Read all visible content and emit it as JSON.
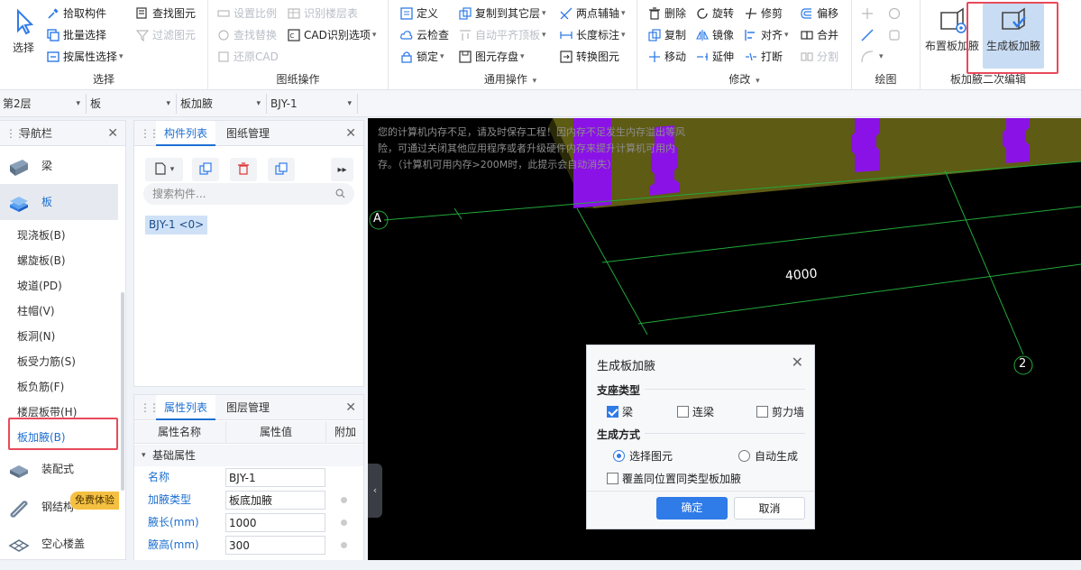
{
  "ribbon": {
    "select_group": {
      "big_button": "选择",
      "items": [
        "拾取构件",
        "批量选择",
        "按属性选择"
      ],
      "items2": [
        "查找图元",
        "过滤图元"
      ],
      "label": "选择"
    },
    "drawing_ops": {
      "items": [
        "设置比例",
        "查找替换",
        "还原CAD"
      ],
      "items2": [
        "识别楼层表",
        "CAD识别选项"
      ],
      "label": "图纸操作"
    },
    "common_ops": {
      "col1": [
        "定义",
        "云检查",
        "锁定"
      ],
      "col2": [
        "复制到其它层",
        "自动平齐顶板",
        "图元存盘"
      ],
      "col3": [
        "两点辅轴",
        "长度标注",
        "转换图元"
      ],
      "label": "通用操作"
    },
    "modify": {
      "col1": [
        "删除",
        "复制",
        "移动"
      ],
      "col2": [
        "旋转",
        "镜像",
        "延伸"
      ],
      "col3": [
        "修剪",
        "对齐",
        "打断"
      ],
      "col4": [
        "偏移",
        "合并",
        "分割"
      ],
      "label": "修改"
    },
    "draw": {
      "label": "绘图"
    },
    "haunch_edit": {
      "btn_place": "布置板加腋",
      "btn_generate": "生成板加腋",
      "label": "板加腋二次编辑"
    }
  },
  "combos": [
    "第2层",
    "板",
    "板加腋",
    "BJY-1"
  ],
  "nav": {
    "title": "导航栏",
    "items_big": [
      "梁",
      "板"
    ],
    "sub_items": [
      "现浇板(B)",
      "螺旋板(B)",
      "坡道(PD)",
      "柱帽(V)",
      "板洞(N)",
      "板受力筋(S)",
      "板负筋(F)",
      "楼层板带(H)",
      "板加腋(B)"
    ],
    "items_bottom": [
      "装配式",
      "钢结构",
      "空心楼盖"
    ],
    "badge": "免费体验"
  },
  "component_panel": {
    "tabs": [
      "构件列表",
      "图纸管理"
    ],
    "search_placeholder": "搜索构件...",
    "items": [
      "BJY-1 <0>"
    ]
  },
  "property_panel": {
    "tabs": [
      "属性列表",
      "图层管理"
    ],
    "headers": [
      "属性名称",
      "属性值",
      "附加"
    ],
    "section": "基础属性",
    "rows": [
      {
        "name": "名称",
        "value": "BJY-1"
      },
      {
        "name": "加腋类型",
        "value": "板底加腋"
      },
      {
        "name": "腋长(mm)",
        "value": "1000"
      },
      {
        "name": "腋高(mm)",
        "value": "300"
      }
    ]
  },
  "canvas": {
    "warning_line1": "您的计算机内存不足，请及时保存工程！因内存不足发生内存溢出等风",
    "warning_line2": "险，可通过关闭其他应用程序或者升级硬件内存来提升计算机可用内",
    "warning_line3": "存。（计算机可用内存>200M时，此提示会自动消失）",
    "axis_a": "A",
    "axis_2": "2",
    "dimension": "4000"
  },
  "dialog": {
    "title": "生成板加腋",
    "support_type_label": "支座类型",
    "support_options": [
      {
        "label": "梁",
        "checked": true
      },
      {
        "label": "连梁",
        "checked": false
      },
      {
        "label": "剪力墙",
        "checked": false
      }
    ],
    "method_label": "生成方式",
    "method_options": [
      {
        "label": "选择图元",
        "selected": true
      },
      {
        "label": "自动生成",
        "selected": false
      }
    ],
    "override_label": "覆盖同位置同类型板加腋",
    "ok": "确定",
    "cancel": "取消"
  },
  "colors": {
    "accent": "#1d6fd1",
    "highlight": "#e84a5a",
    "purple": "#8b12e6",
    "olive": "#5e5b14",
    "grid": "#22a83a"
  }
}
